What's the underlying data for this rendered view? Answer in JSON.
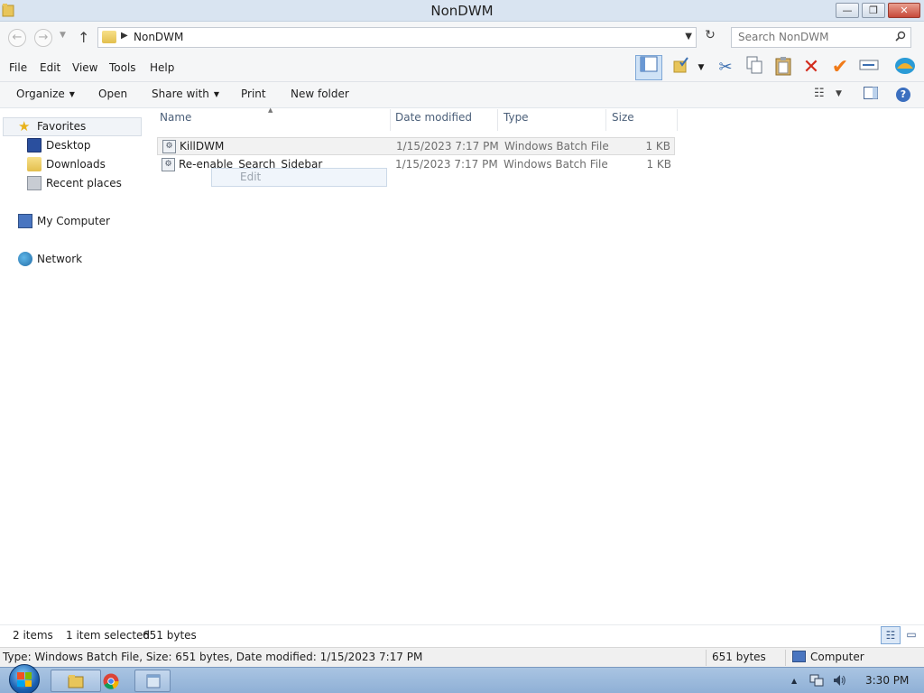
{
  "window": {
    "title": "NonDWM",
    "controls": {
      "minimize": "—",
      "maximize": "❐",
      "close": "✕"
    }
  },
  "address": {
    "back": "←",
    "forward": "→",
    "up": "↑",
    "crumb": "NonDWM",
    "refresh": "↻",
    "search_placeholder": "Search NonDWM"
  },
  "menu": {
    "items": [
      "File",
      "Edit",
      "View",
      "Tools",
      "Help"
    ]
  },
  "toolbar_icons": [
    "layout-icon",
    "folder-check-icon",
    "scissors-icon",
    "copy-icon",
    "paste-icon",
    "delete-icon",
    "checkmark-icon",
    "rename-icon",
    "shell-icon"
  ],
  "commands": {
    "organize": "Organize",
    "open": "Open",
    "share_with": "Share with",
    "print": "Print",
    "new_folder": "New folder"
  },
  "nav": {
    "favorites": "Favorites",
    "desktop": "Desktop",
    "downloads": "Downloads",
    "recent_places": "Recent places",
    "my_computer": "My Computer",
    "network": "Network"
  },
  "columns": {
    "name": "Name",
    "date": "Date modified",
    "type": "Type",
    "size": "Size"
  },
  "files": [
    {
      "name": "KillDWM",
      "date": "1/15/2023 7:17 PM",
      "type": "Windows Batch File",
      "size": "1 KB",
      "selected": true
    },
    {
      "name": "Re-enable_Search_Sidebar",
      "date": "1/15/2023 7:17 PM",
      "type": "Windows Batch File",
      "size": "1 KB",
      "selected": false
    }
  ],
  "context_hint": "Edit",
  "details_bar": {
    "items_count": "2 items",
    "selected": "1 item selected",
    "size": "651 bytes"
  },
  "status_bar": {
    "description": "Type: Windows Batch File, Size: 651 bytes, Date modified: 1/15/2023 7:17 PM",
    "size": "651 bytes",
    "zone": "Computer"
  },
  "taskbar": {
    "clock": "3:30 PM",
    "tray_arrow": "▲"
  },
  "colors": {
    "titlebar": "#d9e4f1",
    "taskbar": "#a9c4e2",
    "close_button": "#c7493a",
    "accent": "#7ea7d6"
  }
}
